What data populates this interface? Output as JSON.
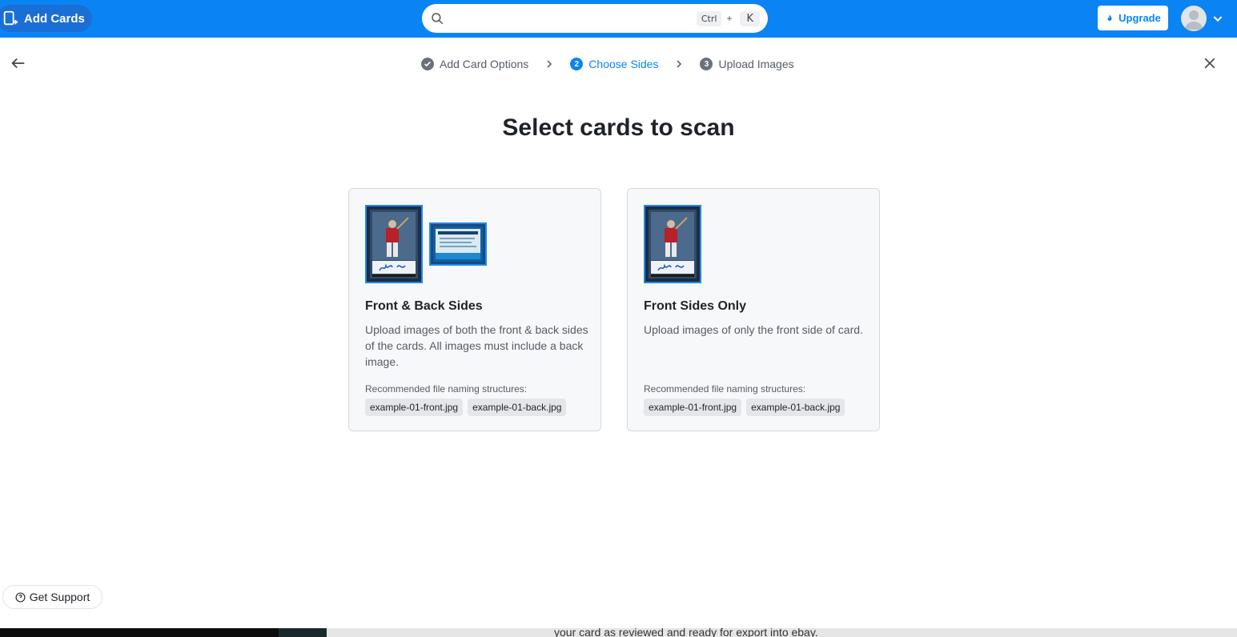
{
  "topbar": {
    "add_cards_label": "Add Cards",
    "search_placeholder": "",
    "shortcut_key1": "Ctrl",
    "shortcut_plus": "+",
    "shortcut_key2": "K",
    "upgrade_label": "Upgrade"
  },
  "stepper": {
    "steps": [
      {
        "label": "Add Card Options",
        "number": "",
        "status": "done"
      },
      {
        "label": "Choose Sides",
        "number": "2",
        "status": "active"
      },
      {
        "label": "Upload Images",
        "number": "3",
        "status": "todo"
      }
    ]
  },
  "main": {
    "heading": "Select cards to scan"
  },
  "cards": [
    {
      "title": "Front & Back Sides",
      "description": "Upload images of both the front & back sides of the cards. All images must include a back image.",
      "recommended_label": "Recommended file naming structures:",
      "examples": [
        "example-01-front.jpg",
        "example-01-back.jpg"
      ]
    },
    {
      "title": "Front Sides Only",
      "description": "Upload images of only the front side of card.",
      "recommended_label": "Recommended file naming structures:",
      "examples": [
        "example-01-front.jpg",
        "example-01-back.jpg"
      ]
    }
  ],
  "support": {
    "label": "Get Support"
  },
  "bottom_strip": {
    "text": "your card as reviewed and ready for export into ebay."
  },
  "colors": {
    "brand": "#0b84f3",
    "accent_border": "#1e88f0",
    "card_bg": "#f7f8fa",
    "chip_bg": "#e4e6ea"
  }
}
